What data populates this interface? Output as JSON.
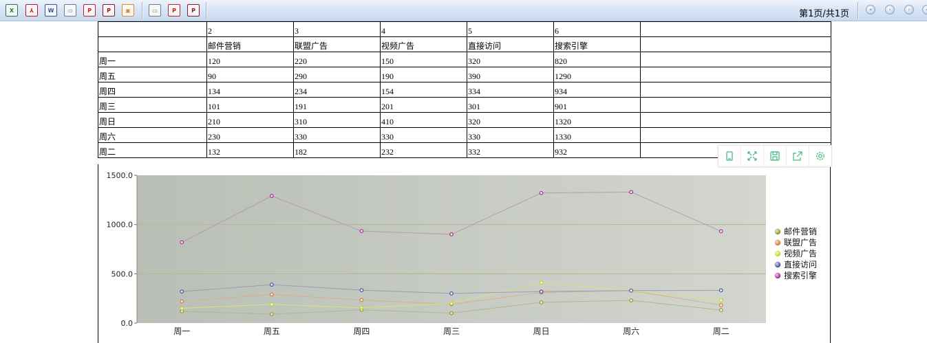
{
  "toolbar": {
    "buttons": [
      {
        "name": "export-excel-icon",
        "glyph": "X",
        "color": "#1f7a3a"
      },
      {
        "name": "export-pdf-icon",
        "glyph": "⅄",
        "color": "#c8102e"
      },
      {
        "name": "export-word-icon",
        "glyph": "W",
        "color": "#2b5797"
      },
      {
        "name": "print-icon",
        "glyph": "▭",
        "color": "#6b7a8c"
      },
      {
        "name": "pdf-print-icon",
        "glyph": "P",
        "color": "#b8202a"
      },
      {
        "name": "pdf-print-2-icon",
        "glyph": "P",
        "color": "#8c1520"
      },
      {
        "name": "export-image-icon",
        "glyph": "▣",
        "color": "#e08a1e"
      },
      {
        "name": "print-2-icon",
        "glyph": "▭",
        "color": "#6b7a8c"
      },
      {
        "name": "pdf-print-3-icon",
        "glyph": "P",
        "color": "#b8202a"
      },
      {
        "name": "pdf-print-4-icon",
        "glyph": "P",
        "color": "#8c1520"
      }
    ],
    "page_info": "第1页/共1页",
    "nav": [
      {
        "name": "first-page-icon",
        "glyph": "«"
      },
      {
        "name": "prev-page-icon",
        "glyph": "‹"
      },
      {
        "name": "next-page-icon",
        "glyph": "›"
      },
      {
        "name": "last-page-icon",
        "glyph": "»"
      }
    ]
  },
  "table": {
    "index_row": [
      "",
      "2",
      "3",
      "4",
      "5",
      "6",
      ""
    ],
    "header_row": [
      "",
      "邮件营销",
      "联盟广告",
      "视频广告",
      "直接访问",
      "搜索引擎",
      ""
    ],
    "rows": [
      [
        "周一",
        "120",
        "220",
        "150",
        "320",
        "820",
        ""
      ],
      [
        "周五",
        "90",
        "290",
        "190",
        "390",
        "1290",
        ""
      ],
      [
        "周四",
        "134",
        "234",
        "154",
        "334",
        "934",
        ""
      ],
      [
        "周三",
        "101",
        "191",
        "201",
        "301",
        "901",
        ""
      ],
      [
        "周日",
        "210",
        "310",
        "410",
        "320",
        "1320",
        ""
      ],
      [
        "周六",
        "230",
        "330",
        "330",
        "330",
        "1330",
        ""
      ],
      [
        "周二",
        "132",
        "182",
        "232",
        "332",
        "932",
        ""
      ]
    ]
  },
  "float_tools": [
    {
      "name": "mobile-view-icon"
    },
    {
      "name": "fullscreen-icon"
    },
    {
      "name": "save-icon"
    },
    {
      "name": "share-export-icon"
    },
    {
      "name": "settings-icon"
    }
  ],
  "colors": {
    "accent_green": "#3db87a",
    "plot_bg_left": "#b9bfb6",
    "plot_bg_right": "#d3d6cf",
    "gridline": "#b7b48e"
  },
  "chart_data": {
    "type": "line",
    "categories": [
      "周一",
      "周五",
      "周四",
      "周三",
      "周日",
      "周六",
      "周二"
    ],
    "ylim": [
      0,
      1500
    ],
    "yticks": [
      "0.0",
      "500.0",
      "1000.0",
      "1500.0"
    ],
    "grid": true,
    "legend_position": "right",
    "series": [
      {
        "name": "邮件营销",
        "values": [
          120,
          90,
          134,
          101,
          210,
          230,
          132
        ],
        "color": "#8a8a10",
        "line": "#b5b58a"
      },
      {
        "name": "联盟广告",
        "values": [
          220,
          290,
          234,
          191,
          310,
          330,
          182
        ],
        "color": "#d06a1a",
        "line": "#d8b08a"
      },
      {
        "name": "视频广告",
        "values": [
          150,
          190,
          154,
          201,
          410,
          330,
          232
        ],
        "color": "#b8d410",
        "line": "#d8e080"
      },
      {
        "name": "直接访问",
        "values": [
          320,
          390,
          334,
          301,
          320,
          330,
          332
        ],
        "color": "#3a3aa0",
        "line": "#9a9ab8"
      },
      {
        "name": "搜索引擎",
        "values": [
          820,
          1290,
          934,
          901,
          1320,
          1330,
          932
        ],
        "color": "#a0108a",
        "line": "#b79ab4"
      }
    ]
  }
}
